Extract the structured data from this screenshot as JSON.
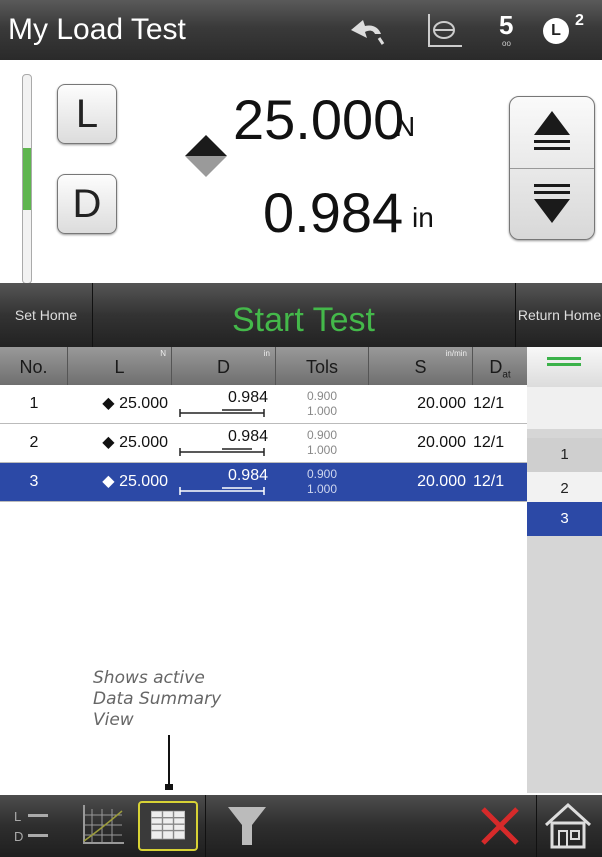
{
  "header": {
    "title": "My Load Test",
    "speed_glyph": "5",
    "speed_sub": "oo",
    "load_badge": "L",
    "load_badge_sup": "2"
  },
  "readout": {
    "load_button": "L",
    "disp_button": "D",
    "load_value": "25.000",
    "load_unit": "N",
    "disp_value": "0.984",
    "disp_unit": "in",
    "level_fraction": 0.3
  },
  "actions": {
    "set_home": "Set Home",
    "start_test": "Start Test",
    "return_home": "Return Home"
  },
  "table": {
    "columns": [
      {
        "label": "No.",
        "unit": ""
      },
      {
        "label": "L",
        "unit": "N"
      },
      {
        "label": "D",
        "unit": "in"
      },
      {
        "label": "Tols",
        "unit": ""
      },
      {
        "label": "S",
        "unit": "in/min"
      },
      {
        "label": "D",
        "sub": "at",
        "unit": ""
      }
    ],
    "rows": [
      {
        "no": "1",
        "load": "25.000",
        "disp": "0.984",
        "tol_low": "0.900",
        "tol_high": "1.000",
        "speed": "20.000",
        "date": "12/1"
      },
      {
        "no": "2",
        "load": "25.000",
        "disp": "0.984",
        "tol_low": "0.900",
        "tol_high": "1.000",
        "speed": "20.000",
        "date": "12/1"
      },
      {
        "no": "3",
        "load": "25.000",
        "disp": "0.984",
        "tol_low": "0.900",
        "tol_high": "1.000",
        "speed": "20.000",
        "date": "12/1"
      }
    ],
    "selected_row": 3
  },
  "index_strip": [
    "1",
    "2",
    "3"
  ],
  "callout": "Shows active\nData Summary\nView",
  "icons": {
    "undo": "undo-icon",
    "hplot": "h-plot-icon",
    "speed": "speed-icon",
    "load_badge": "load-badge-icon",
    "jog_up": "jog-up-icon",
    "jog_down": "jog-down-icon",
    "menu": "menu-icon",
    "ld_view": "ld-view-icon",
    "chart": "chart-view-icon",
    "summary": "data-summary-icon",
    "filter": "filter-icon",
    "delete": "delete-icon",
    "home": "home-icon"
  },
  "colors": {
    "accent_green": "#44b84a",
    "selection_blue": "#2c49a6",
    "highlight_yellow": "#d7d235",
    "delete_red": "#d62a2a"
  }
}
